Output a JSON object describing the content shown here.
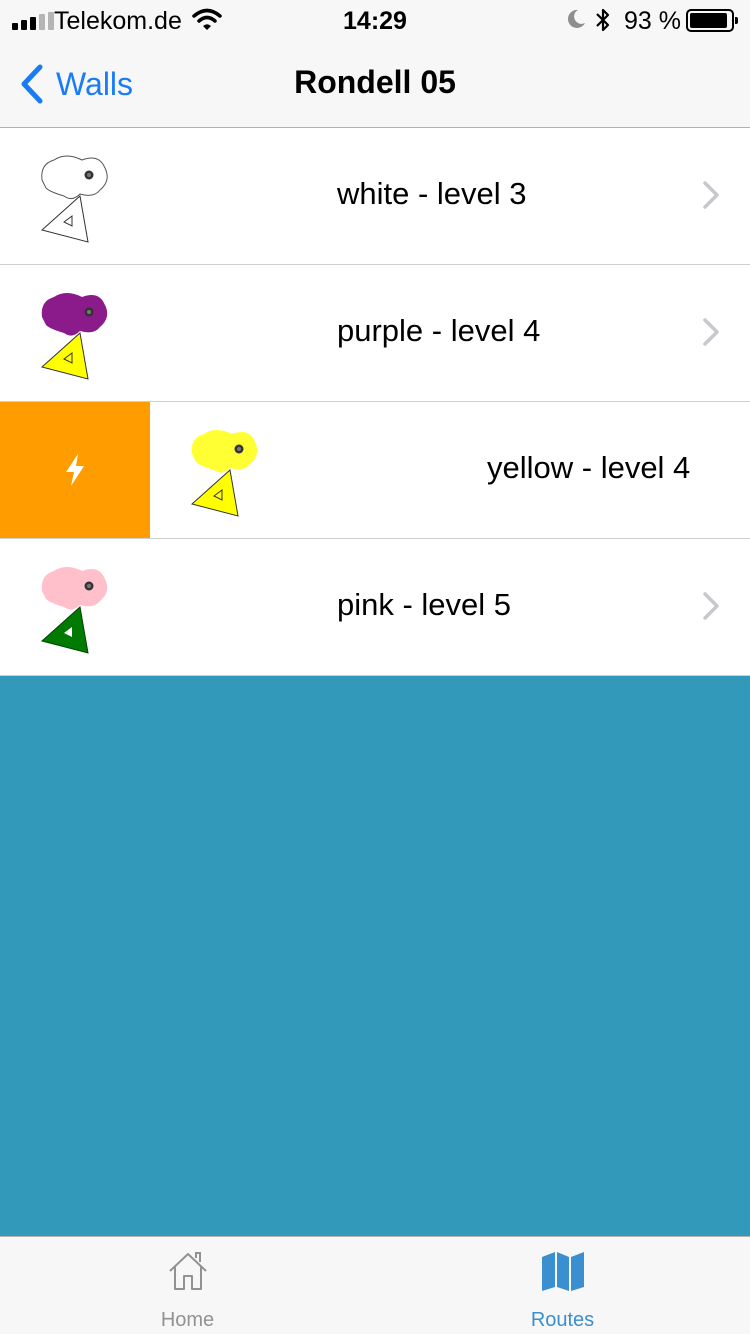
{
  "status_bar": {
    "carrier": "Telekom.de",
    "time": "14:29",
    "battery_percent": "93 %",
    "battery_level": 0.93
  },
  "nav": {
    "back_label": "Walls",
    "title": "Rondell 05"
  },
  "routes": [
    {
      "label": "white - level 3",
      "hold_color": "#ffffff",
      "tag_color": "#ffffff",
      "swiped": false
    },
    {
      "label": "purple - level 4",
      "hold_color": "#8b1a8b",
      "tag_color": "#ffff00",
      "swiped": false
    },
    {
      "label": "yellow - level 4",
      "hold_color": "#ffff33",
      "tag_color": "#ffff00",
      "swiped": true
    },
    {
      "label": "pink - level 5",
      "hold_color": "#ffc0cb",
      "tag_color": "#007a00",
      "swiped": false
    }
  ],
  "swipe_action": {
    "color": "#ff9c00",
    "icon": "lightning-icon"
  },
  "tabs": [
    {
      "label": "Home",
      "icon": "home-icon",
      "active": false
    },
    {
      "label": "Routes",
      "icon": "map-icon",
      "active": true
    }
  ],
  "colors": {
    "accent": "#1a7cf5",
    "tab_active": "#3a8fd0",
    "tab_inactive": "#929292",
    "background": "#3399bb"
  }
}
